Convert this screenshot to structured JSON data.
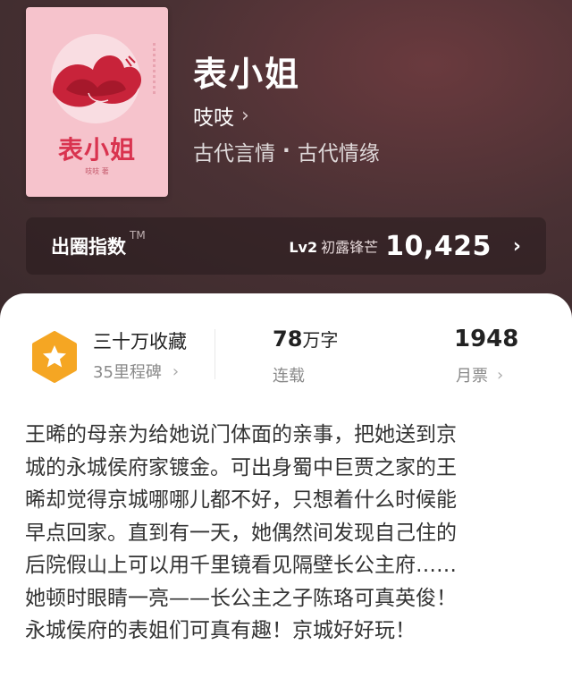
{
  "book": {
    "cover_title": "表小姐",
    "cover_author": "吱吱 著",
    "title": "表小姐",
    "author": "吱吱",
    "genres": [
      "古代言情",
      "古代情缘"
    ],
    "genre_separator": "·"
  },
  "index": {
    "label": "出圈指数",
    "trademark": "TM",
    "level": "Lv2",
    "level_name": "初露锋芒",
    "score": "10,425"
  },
  "stats": {
    "collection_title": "三十万收藏",
    "milestones": "35里程碑",
    "word_count": "78",
    "word_unit": "万字",
    "status": "连载",
    "monthly_votes": "1948",
    "monthly_votes_label": "月票"
  },
  "synopsis": [
    "王晞的母亲为给她说门体面的亲事，把她送到京",
    "城的永城侯府家镀金。可出身蜀中巨贾之家的王",
    "晞却觉得京城哪哪儿都不好，只想着什么时候能",
    "早点回家。直到有一天，她偶然间发现自己住的",
    "后院假山上可以用千里镜看见隔壁长公主府……",
    "她顿时眼睛一亮——长公主之子陈珞可真英俊！",
    "永城侯府的表姐们可真有趣！京城好好玩！"
  ],
  "colors": {
    "badge": "#f5a623",
    "cover": "#f6c3cc",
    "cover_title": "#d9334f"
  }
}
